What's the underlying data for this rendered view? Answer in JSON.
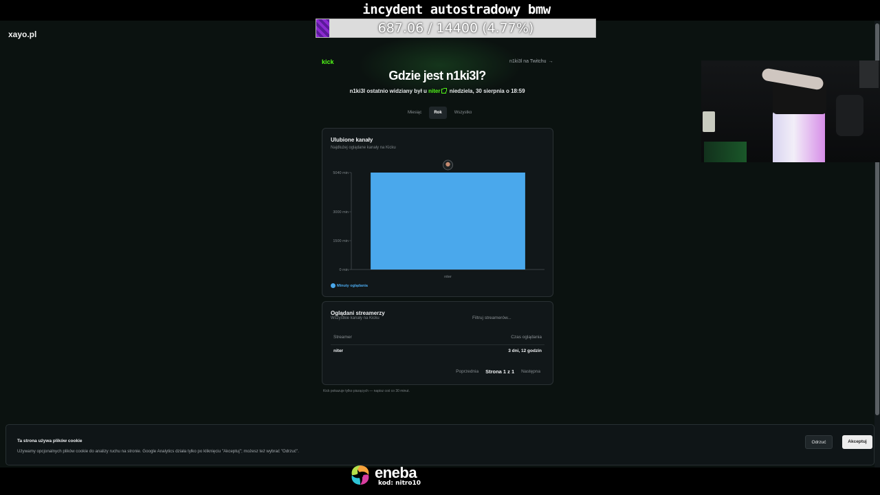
{
  "overlay": {
    "title": "incydent autostradowy bmw",
    "progress_text": "687.06 / 14400 (4.77%)",
    "progress_fraction": 0.0477,
    "progress_color": "#8b2ad0"
  },
  "site": {
    "logo": "xayo.pl",
    "platform": "kick",
    "twitch_link": "n1ki3l na Twitchu",
    "twitch_arrow": "→",
    "heading": "Gdzie jest n1ki3l?",
    "last_seen": {
      "prefix": "n1ki3l ostatnio widziany był u",
      "channel": "niter",
      "suffix": "niedziela, 30 sierpnia o 18:59"
    },
    "tabs": [
      {
        "label": "Miesiąc",
        "active": false
      },
      {
        "label": "Rok",
        "active": true
      },
      {
        "label": "Wszystko",
        "active": false
      }
    ],
    "favorites_card": {
      "title": "Ulubione kanały",
      "subtitle": "Najdłużej oglądane kanały na Kicku",
      "legend": "Minuty oglądania"
    },
    "watched_card": {
      "title": "Oglądani streamerzy",
      "subtitle": "Wszystkie kanały na Kicku",
      "filter_placeholder": "Filtruj streamerów...",
      "columns": [
        "Streamer",
        "Czas oglądania"
      ],
      "rows": [
        {
          "streamer": "niter",
          "time": "3 dni, 12 godzin"
        }
      ],
      "pager": {
        "prev": "Poprzednia",
        "page": "Strona 1 z 1",
        "next": "Następna"
      }
    },
    "footnote": "Kick pokazuje tylko piszących — napisz coś co 30 minut.",
    "cookie": {
      "title": "Ta strona używa plików cookie",
      "text": "Używamy opcjonalnych plików cookie do analizy ruchu na stronie. Google Analytics działa tylko po kliknięciu \"Akceptuj\"; możesz też wybrać \"Odrzuć\".",
      "reject": "Odrzuć",
      "accept": "Akceptuj"
    }
  },
  "sponsor": {
    "name": "eneba",
    "code": "kod: nitro10"
  },
  "chart_data": {
    "type": "bar",
    "categories": [
      "niter"
    ],
    "series": [
      {
        "name": "Minuty oglądania",
        "values": [
          5040
        ]
      }
    ],
    "ylim": [
      0,
      5040
    ],
    "yticks": [
      0,
      1500,
      3000,
      5040
    ],
    "ytick_labels": [
      "0 min",
      "1500 min",
      "3000 min",
      "5040 min"
    ],
    "bar_color": "#4aa8ec",
    "legend_position": "bottom-left",
    "grid": false
  }
}
